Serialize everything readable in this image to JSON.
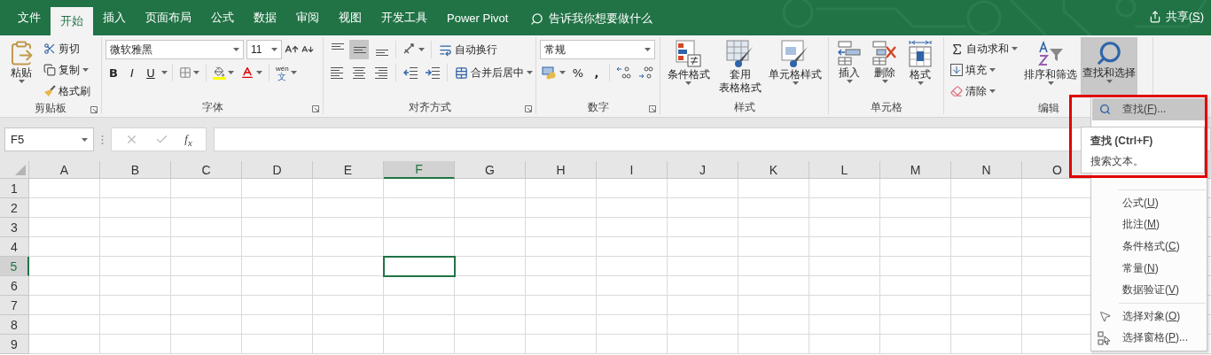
{
  "tabs": [
    {
      "label": "文件",
      "selected": false
    },
    {
      "label": "开始",
      "selected": true
    },
    {
      "label": "插入",
      "selected": false
    },
    {
      "label": "页面布局",
      "selected": false
    },
    {
      "label": "公式",
      "selected": false
    },
    {
      "label": "数据",
      "selected": false
    },
    {
      "label": "审阅",
      "selected": false
    },
    {
      "label": "视图",
      "selected": false
    },
    {
      "label": "开发工具",
      "selected": false
    },
    {
      "label": "Power Pivot",
      "selected": false
    }
  ],
  "tell_me": {
    "placeholder": "告诉我你想要做什么"
  },
  "share": {
    "label": "共享(",
    "key": "S",
    "after": ")"
  },
  "ribbon": {
    "clipboard": {
      "label": "剪贴板",
      "paste": "粘贴",
      "cut": "剪切",
      "copy": "复制",
      "format_painter": "格式刷"
    },
    "font": {
      "label": "字体",
      "font_name": "微软雅黑",
      "font_size": "11",
      "bold": "B",
      "italic": "I",
      "underline": "U",
      "phonetic_top": "wén",
      "phonetic_bottom": "文"
    },
    "alignment": {
      "label": "对齐方式",
      "vertical": [
        {
          "selected": false
        },
        {
          "selected": true
        },
        {
          "selected": false
        }
      ],
      "wrap_text": "自动换行",
      "merge_center": "合并后居中"
    },
    "number": {
      "label": "数字",
      "format": "常规",
      "percent": "%",
      "comma": ","
    },
    "styles": {
      "label": "样式",
      "conditional": "条件格式",
      "table_line1": "套用",
      "table_line2": "表格格式",
      "cell_styles": "单元格样式"
    },
    "cells": {
      "label": "单元格",
      "insert": "插入",
      "delete": "删除",
      "format": "格式"
    },
    "editing": {
      "label": "编辑",
      "autosum": "自动求和",
      "fill": "填充",
      "clear": "清除",
      "sort_filter": "排序和筛选",
      "find_select": {
        "label": "查找和选择",
        "expanded": true
      }
    }
  },
  "formula_bar": {
    "name_box": "F5",
    "function_label": "f$_{x}$"
  },
  "grid": {
    "columns": [
      {
        "label": "A",
        "selected": false
      },
      {
        "label": "B",
        "selected": false
      },
      {
        "label": "C",
        "selected": false
      },
      {
        "label": "D",
        "selected": false
      },
      {
        "label": "E",
        "selected": false
      },
      {
        "label": "F",
        "selected": true
      },
      {
        "label": "G",
        "selected": false
      },
      {
        "label": "H",
        "selected": false
      },
      {
        "label": "I",
        "selected": false
      },
      {
        "label": "J",
        "selected": false
      },
      {
        "label": "K",
        "selected": false
      },
      {
        "label": "L",
        "selected": false
      },
      {
        "label": "M",
        "selected": false
      },
      {
        "label": "N",
        "selected": false
      },
      {
        "label": "O",
        "selected": false
      }
    ],
    "rows": [
      {
        "label": "1",
        "selected": false
      },
      {
        "label": "2",
        "selected": false
      },
      {
        "label": "3",
        "selected": false
      },
      {
        "label": "4",
        "selected": false
      },
      {
        "label": "5",
        "selected": true
      },
      {
        "label": "6",
        "selected": false
      },
      {
        "label": "7",
        "selected": false
      },
      {
        "label": "8",
        "selected": false
      },
      {
        "label": "9",
        "selected": false
      }
    ]
  },
  "find_menu": {
    "items": [
      {
        "kind": "item",
        "label": "查找(",
        "key": "F",
        "after": ")...",
        "selected": true
      },
      {
        "kind": "separator"
      },
      {
        "kind": "item",
        "label": "公式(",
        "key": "U",
        "after": ")",
        "selected": false
      },
      {
        "kind": "item",
        "label": "批注(",
        "key": "M",
        "after": ")",
        "selected": false
      },
      {
        "kind": "item",
        "label": "条件格式(",
        "key": "C",
        "after": ")",
        "selected": false
      },
      {
        "kind": "item",
        "label": "常量(",
        "key": "N",
        "after": ")",
        "selected": false
      },
      {
        "kind": "item",
        "label": "数据验证(",
        "key": "V",
        "after": ")",
        "selected": false
      },
      {
        "kind": "separator"
      },
      {
        "kind": "item",
        "label": "选择对象(",
        "key": "O",
        "after": ")",
        "selected": false
      },
      {
        "kind": "item",
        "label": "选择窗格(",
        "key": "P",
        "after": ")...",
        "selected": false
      }
    ]
  },
  "tooltip": {
    "title": "查找 (Ctrl+F)",
    "description": "搜索文本。"
  }
}
